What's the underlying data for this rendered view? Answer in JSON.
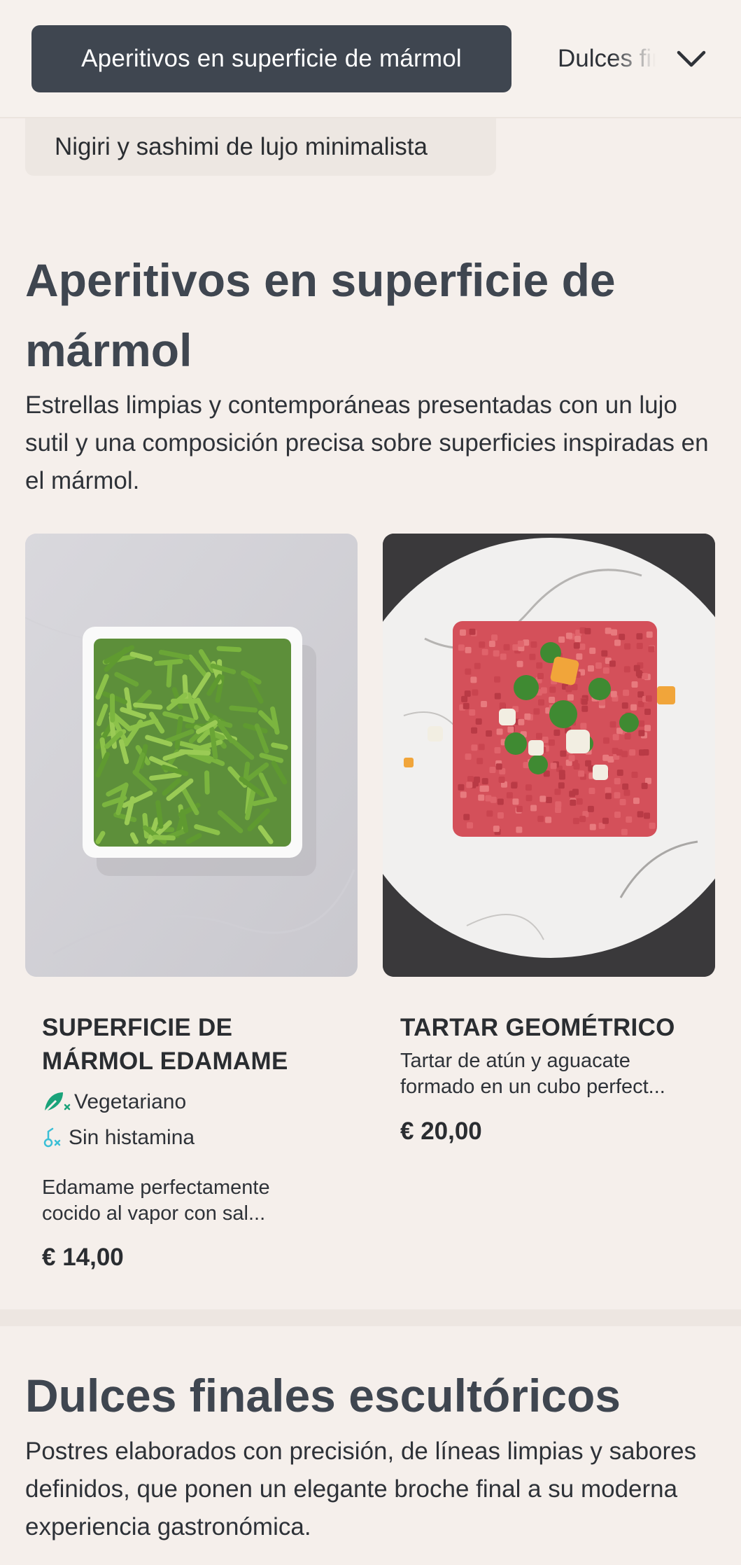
{
  "category_bar": {
    "active": "Aperitivos en superficie de mármol",
    "next": "Dulces finales escultóricos",
    "menu_icon": "chevron-down-icon"
  },
  "sub_category": "Nigiri y sashimi de lujo minimalista",
  "section": {
    "title": "Aperitivos en superficie de mármol",
    "description": "Estrellas limpias y contemporáneas presentadas con un lujo sutil y una composición precisa sobre superficies inspiradas en el mármol."
  },
  "items": [
    {
      "name": "SUPERFICIE DE MÁRMOL EDAMAME",
      "tags": [
        {
          "icon": "vegetarian-icon",
          "label": "Vegetariano",
          "color": "#1aa37a"
        },
        {
          "icon": "histamine-free-icon",
          "label": "Sin histamina",
          "color": "#3bbfd6"
        }
      ],
      "description": "Edamame perfectamente cocido al vapor con sal...",
      "price": "€ 14,00"
    },
    {
      "name": "TARTAR GEOMÉTRICO",
      "description": "Tartar de atún y aguacate formado en un cubo perfect...",
      "price": "€ 20,00"
    }
  ],
  "next_section": {
    "title": "Dulces finales escultóricos",
    "description": "Postres elaborados con precisión, de líneas limpias y sabores definidos, que ponen un elegante broche final a su moderna experiencia gastronómica."
  }
}
